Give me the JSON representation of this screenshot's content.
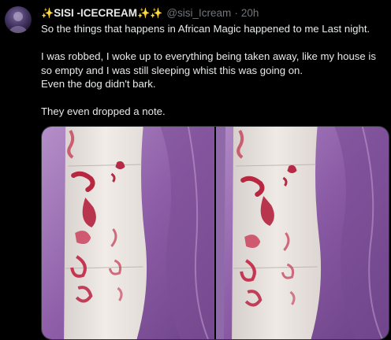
{
  "tweet": {
    "author": {
      "display_name": "SISI -ICECREAM",
      "handle": "@sisi_Icream",
      "avatar_icon": "user-avatar"
    },
    "separator": "·",
    "time": "20h",
    "sparkle_emoji": "✨",
    "paragraphs": [
      "So the things that happens in African Magic happened to me  Last night.",
      "I was robbed, I woke up to everything being taken away, like my house is so empty and I was still sleeping whist this was going on.",
      "Even the dog didn't bark.",
      "They even dropped a note."
    ],
    "media": {
      "photos": [
        {
          "alt_icon": "photo-of-note-left"
        },
        {
          "alt_icon": "photo-of-note-right"
        }
      ]
    },
    "colors": {
      "background": "#000000",
      "text": "#e7e9ea",
      "muted": "#71767b",
      "sparkle": "#f4c430"
    }
  }
}
